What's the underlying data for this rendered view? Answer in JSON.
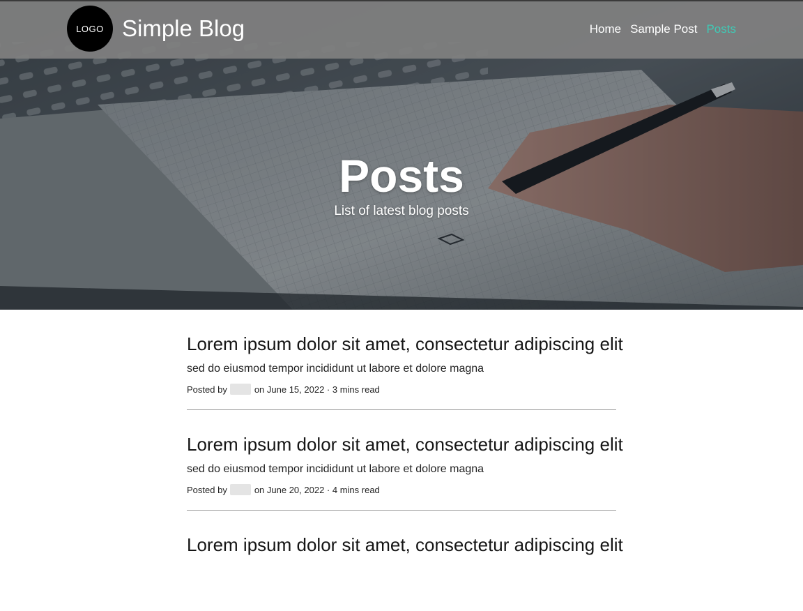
{
  "brand": {
    "logo_text": "LOGO",
    "title": "Simple Blog"
  },
  "nav": {
    "items": [
      {
        "label": "Home",
        "active": false
      },
      {
        "label": "Sample Post",
        "active": false
      },
      {
        "label": "Posts",
        "active": true
      }
    ],
    "active_color": "#40c9b5"
  },
  "hero": {
    "title": "Posts",
    "subtitle": "List of latest blog posts"
  },
  "posts": [
    {
      "title": "Lorem ipsum dolor sit amet, consectetur adipiscing elit",
      "excerpt": "sed do eiusmod tempor incididunt ut labore et dolore magna",
      "posted_by": "Posted by",
      "date_text": "on June 15, 2022 · 3 mins read"
    },
    {
      "title": "Lorem ipsum dolor sit amet, consectetur adipiscing elit",
      "excerpt": "sed do eiusmod tempor incididunt ut labore et dolore magna",
      "posted_by": "Posted by",
      "date_text": "on June 20, 2022 · 4 mins read"
    },
    {
      "title": "Lorem ipsum dolor sit amet, consectetur adipiscing elit"
    }
  ]
}
